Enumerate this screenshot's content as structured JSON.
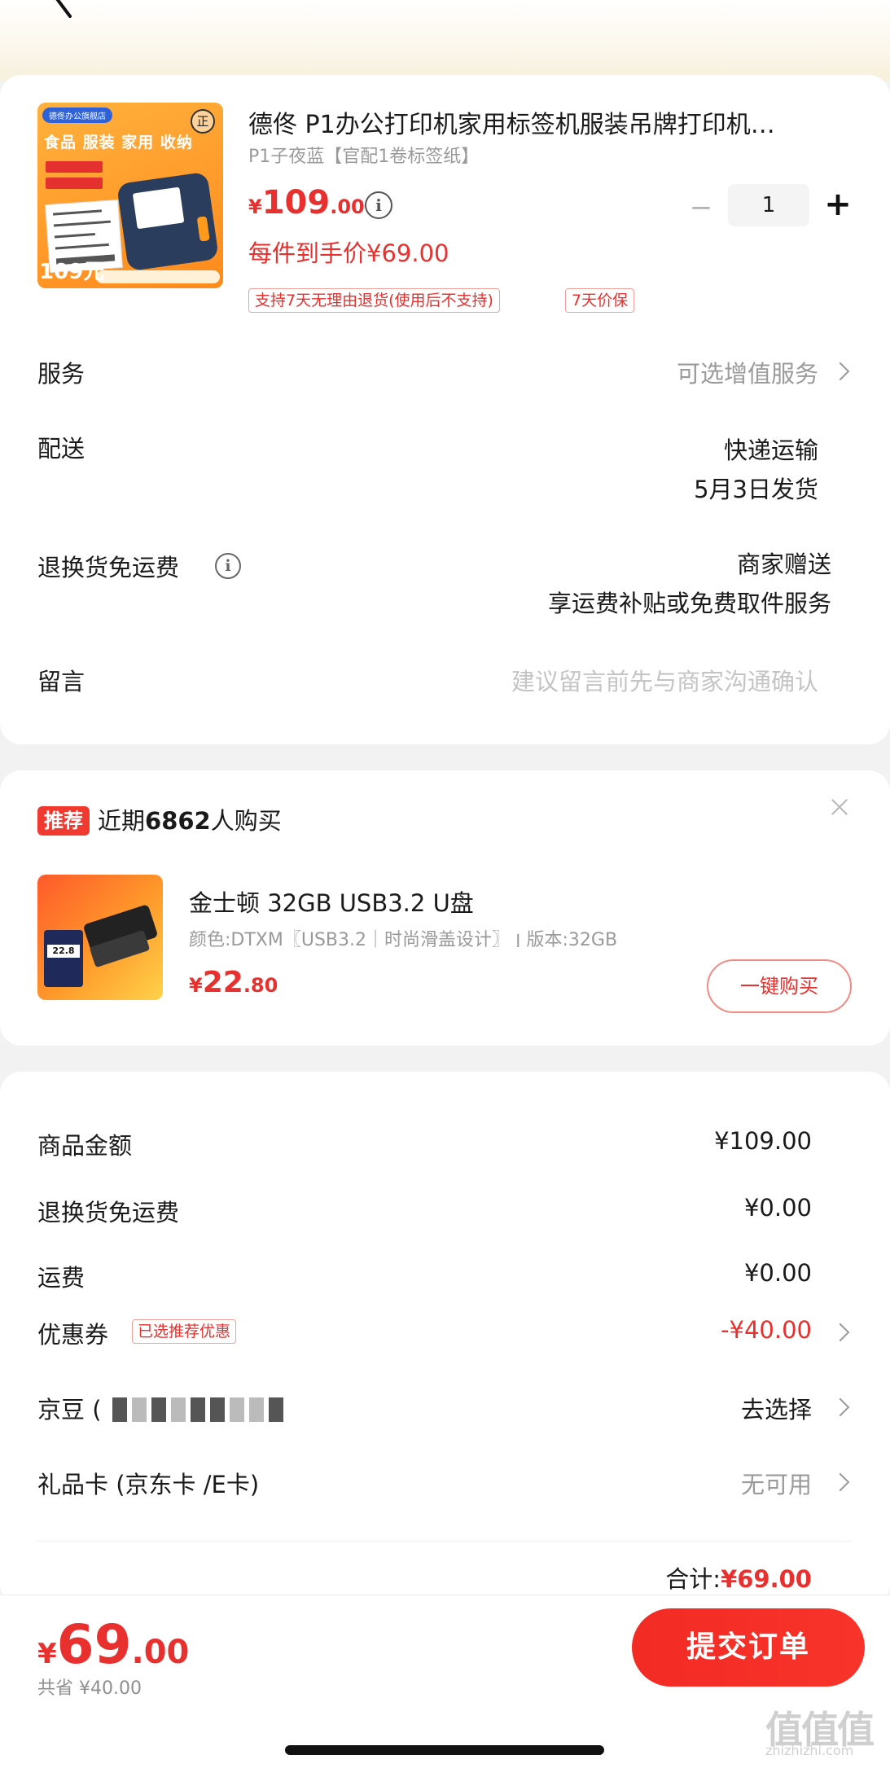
{
  "product": {
    "title": "德佟 P1办公打印机家用标签机服装吊牌打印机…",
    "spec": "P1子夜蓝【官配1卷标签纸】",
    "price_yen": "¥",
    "price_int": "109",
    "price_dec": ".00",
    "info_icon": "i",
    "quantity": "1",
    "minus": "−",
    "plus": "+",
    "unit_price": "每件到手价¥69.00",
    "tags": [
      "支持7天无理由退货(使用后不支持)",
      "7天价保"
    ],
    "thumbnail": {
      "shop_tag": "德佟办公旗舰店",
      "headline": "食品 服装 家用 收纳",
      "badge": "正",
      "price": "109元"
    }
  },
  "rows": {
    "service_label": "服务",
    "service_value": "可选增值服务",
    "delivery_label": "配送",
    "delivery_value_1": "快递运输",
    "delivery_value_2": "5月3日发货",
    "return_label": "退换货免运费",
    "return_info_icon": "i",
    "return_value_1": "商家赠送",
    "return_value_2": "享运费补贴或免费取件服务",
    "message_label": "留言",
    "message_placeholder": "建议留言前先与商家沟通确认"
  },
  "recommend": {
    "badge": "推荐",
    "title_prefix": "近期",
    "title_count": "6862",
    "title_suffix": "人购买",
    "item_name": "金士顿 32GB USB3.2 U盘",
    "item_spec": "颜色:DTXM〖USB3.2｜时尚滑盖设计〗 ׀ 版本:32GB",
    "price_yen": "¥",
    "price_int": "22",
    "price_dec": ".80",
    "buy_button": "一键购买",
    "thumb_value": "22.8"
  },
  "summary": {
    "goods_amount_label": "商品金额",
    "goods_amount_value": "¥109.00",
    "return_fee_label": "退换货免运费",
    "return_fee_value": "¥0.00",
    "shipping_label": "运费",
    "shipping_value": "¥0.00",
    "coupon_label": "优惠券",
    "coupon_tag": "已选推荐优惠",
    "coupon_value": "-¥40.00",
    "jingdou_label": "京豆 (",
    "jingdou_value": "去选择",
    "giftcard_label": "礼品卡 (京东卡 /E卡)",
    "giftcard_value": "无可用",
    "total_label": "合计:",
    "total_value": "¥69.00"
  },
  "bottom": {
    "price_yen": "¥",
    "price_int": "69",
    "price_dec": ".00",
    "saved": "共省 ¥40.00",
    "submit": "提交订单"
  },
  "watermark": {
    "main": "值值值",
    "sub": "zhizhizhi.com"
  },
  "colors": {
    "accent": "#e8302e",
    "submit": "#f22b24",
    "background": "#f2f2f2"
  }
}
